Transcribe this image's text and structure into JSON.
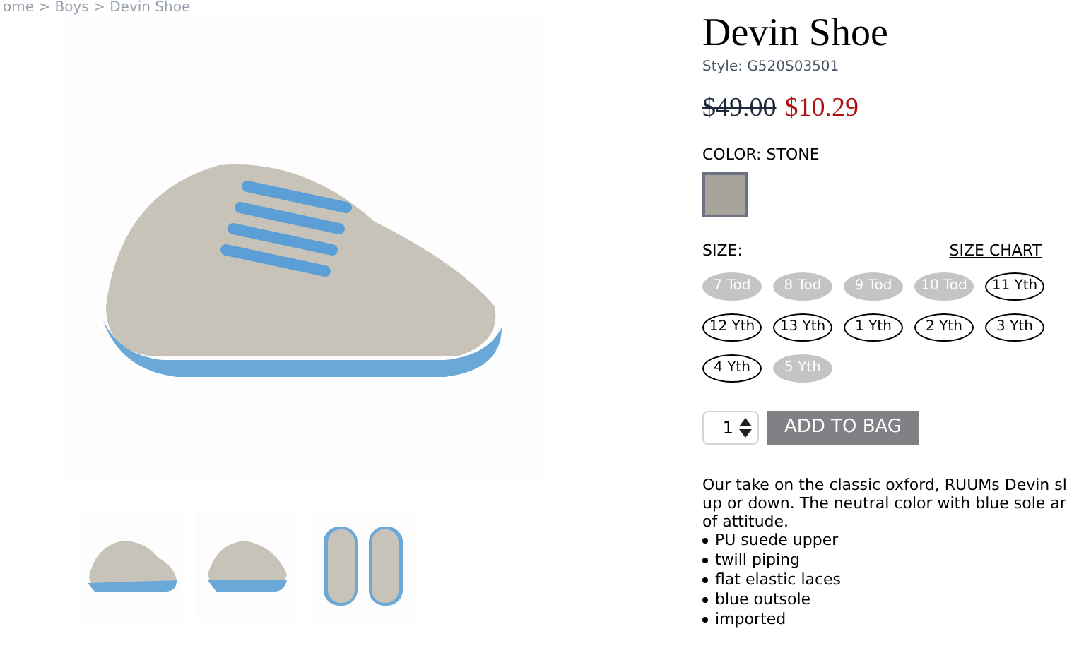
{
  "breadcrumb": "ome > Boys > Devin Shoe",
  "product": {
    "title": "Devin Shoe",
    "style": "Style: G520S03501",
    "old_price": "$49.00",
    "price": "$10.29"
  },
  "color": {
    "label": "COLOR: STONE",
    "swatches": [
      {
        "color": "#a8a49c",
        "selected": true
      }
    ]
  },
  "size": {
    "label": "SIZE:",
    "chart_link": "SIZE CHART",
    "options": [
      {
        "label": "7 Tod",
        "available": false
      },
      {
        "label": "8 Tod",
        "available": false
      },
      {
        "label": "9 Tod",
        "available": false
      },
      {
        "label": "10 Tod",
        "available": false
      },
      {
        "label": "11 Yth",
        "available": true
      },
      {
        "label": "12 Yth",
        "available": true
      },
      {
        "label": "13 Yth",
        "available": true
      },
      {
        "label": "1 Yth",
        "available": true
      },
      {
        "label": "2 Yth",
        "available": true
      },
      {
        "label": "3 Yth",
        "available": true
      },
      {
        "label": "4 Yth",
        "available": true
      },
      {
        "label": "5 Yth",
        "available": false
      }
    ]
  },
  "quantity": "1",
  "add_button": "ADD TO BAG",
  "description": [
    "Our take on the classic oxford, RUUMs Devin sl",
    "up or down. The neutral color with blue sole ar",
    "of attitude."
  ],
  "features": [
    "PU suede upper",
    "twill piping",
    "flat elastic laces",
    "blue outsole",
    "imported"
  ],
  "thumbnails": [
    {
      "kind": "side"
    },
    {
      "kind": "back"
    },
    {
      "kind": "top"
    }
  ]
}
